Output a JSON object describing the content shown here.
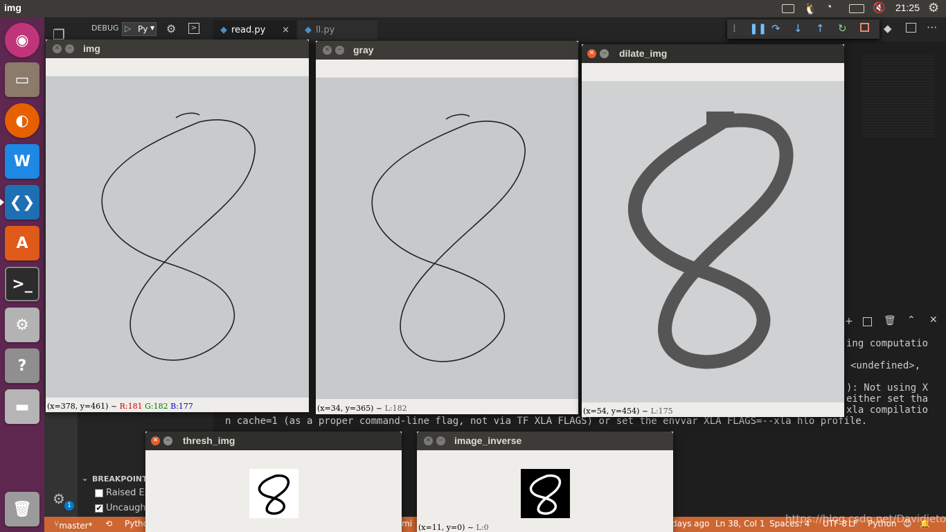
{
  "topbar": {
    "app_name": "img",
    "clock": "21:25"
  },
  "vscode": {
    "debug_label": "DEBUG",
    "debug_config": "Py",
    "tabs": [
      {
        "label": "read.py",
        "close": "×"
      },
      {
        "label": "ll.py"
      }
    ],
    "terminal_lines": [
      "ing computatio",
      "<undefined>,",
      "): Not using X",
      "either set tha",
      "xla compilatio",
      "n cache=1 (as a proper command-line flag, not via TF XLA FLAGS) or set the envvar XLA FLAGS=--xla hlo profile."
    ],
    "breakpoints": {
      "title": "BREAKPOINTS",
      "items": [
        {
          "label": "Raised Ex",
          "checked": false
        },
        {
          "label": "Uncaught",
          "checked": true
        }
      ]
    },
    "badge": "1",
    "statusbar": {
      "branch": "master*",
      "python": "Pytho",
      "terminal": "mina",
      "time_ago": "days ago",
      "position": "Ln 38, Col 1",
      "spaces": "Spaces: 4",
      "encoding": "UTF-8",
      "eol": "LF",
      "language": "Python",
      "watermark": "https://blog.csdn.net/Davidietop"
    }
  },
  "windows": {
    "img": {
      "title": "img",
      "status": "(x=378, y=461) ~",
      "r": "R:181",
      "g": "G:182",
      "b": "B:177"
    },
    "gray": {
      "title": "gray",
      "status": "(x=34, y=365) ~",
      "l": "L:182"
    },
    "dilate": {
      "title": "dilate_img",
      "status": "(x=54, y=454) ~",
      "l": "L:175"
    },
    "thresh": {
      "title": "thresh_img"
    },
    "inverse": {
      "title": "image_inverse",
      "status": "(x=11, y=0) ~",
      "l": "L:0"
    }
  },
  "colors": {
    "ubuntu_topbar": "#3c3b37",
    "launcher": "#5e2750",
    "statusbar_debug": "#cc6633",
    "close_button": "#e85c2c"
  }
}
